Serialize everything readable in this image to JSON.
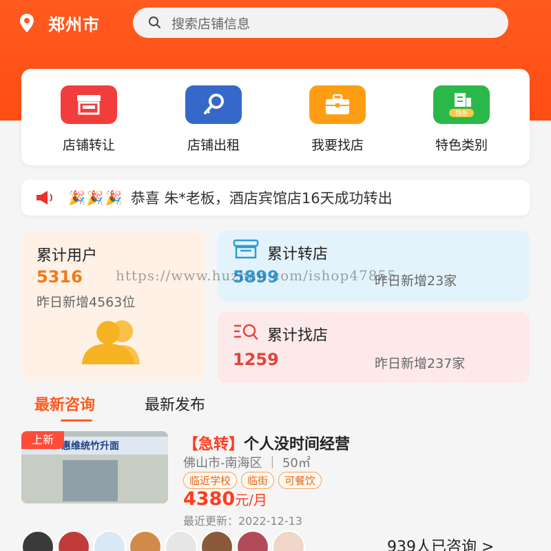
{
  "header": {
    "city": "郑州市",
    "search_placeholder": "搜索店铺信息"
  },
  "menu": [
    {
      "label": "店铺转让",
      "color": "#f23d3d",
      "icon": "store-icon"
    },
    {
      "label": "店铺出租",
      "color": "#3469c9",
      "icon": "key-icon"
    },
    {
      "label": "我要找店",
      "color": "#ff9e14",
      "icon": "briefcase-icon"
    },
    {
      "label": "特色类别",
      "color": "#2bb84a",
      "icon": "building-icon",
      "badge": "特色"
    }
  ],
  "notice": {
    "icons": "🎉🎉🎉",
    "text": "恭喜 朱*老板，酒店宾馆店16天成功转出"
  },
  "stats": {
    "users": {
      "title": "累计用户",
      "value": "5316",
      "sub": "昨日新增4563位",
      "color": "#f07a1a"
    },
    "transfer": {
      "title": "累计转店",
      "value": "5899",
      "sub": "昨日新增23家",
      "color": "#2e9bd6"
    },
    "find": {
      "title": "累计找店",
      "value": "1259",
      "sub": "昨日新增237家",
      "color": "#e0443b"
    }
  },
  "watermark": "https://www.huzhan.com/ishop47855",
  "tabs": {
    "active": "最新咨询",
    "inactive": "最新发布"
  },
  "listing": {
    "badge": "上新",
    "tag": "【急转】",
    "title": "个人没时间经营",
    "meta": "佛山市-南海区 ｜ 50㎡",
    "chips": [
      "临近学校",
      "临街",
      "可餐饮"
    ],
    "price_value": "4380",
    "price_unit": "元/月",
    "updated": "最近更新：2022-12-13",
    "shop_sign": "惠维统竹升面"
  },
  "consult_count": "939人已咨询 >"
}
